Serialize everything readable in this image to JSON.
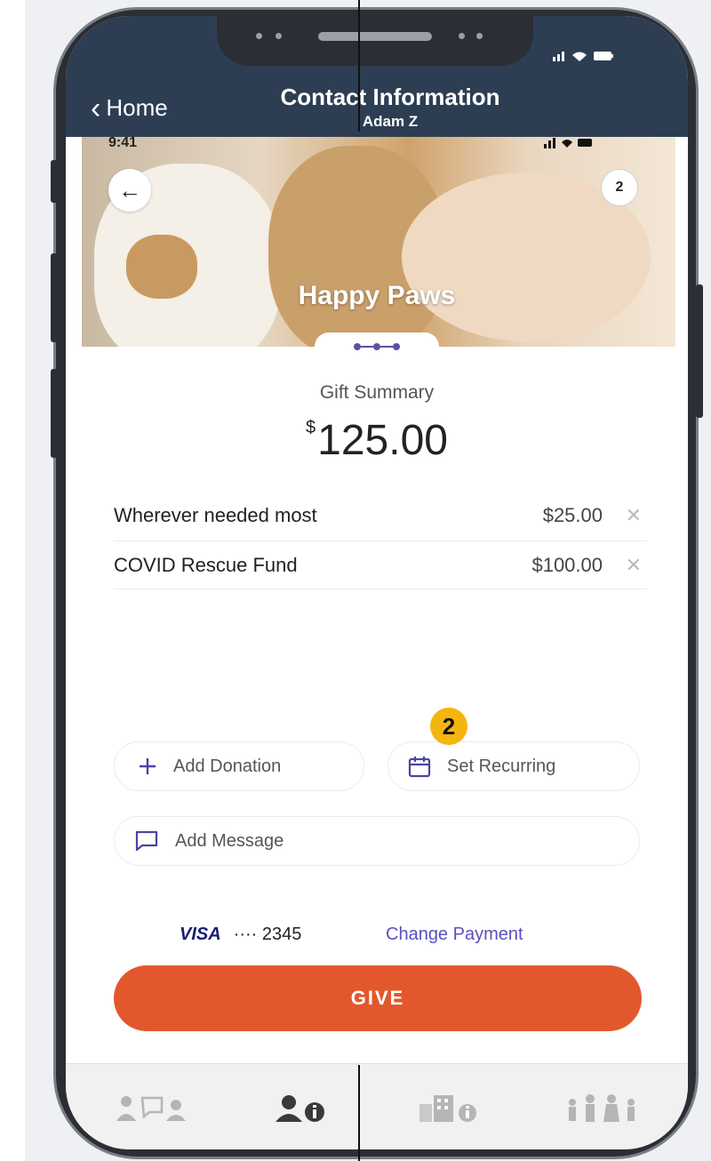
{
  "nav": {
    "back_label": "Home",
    "title": "Contact Information",
    "subtitle": "Adam Z"
  },
  "hero": {
    "status_time": "9:41",
    "title": "Happy Paws",
    "cart_count": "2"
  },
  "summary": {
    "label": "Gift Summary",
    "currency_symbol": "$",
    "amount": "125.00",
    "items": [
      {
        "name": "Wherever needed most",
        "amount": "$25.00"
      },
      {
        "name": "COVID Rescue Fund",
        "amount": "$100.00"
      }
    ]
  },
  "annotation": {
    "marker": "2"
  },
  "actions": {
    "add_donation": "Add Donation",
    "set_recurring": "Set Recurring",
    "add_message": "Add Message"
  },
  "payment": {
    "card_brand": "VISA",
    "card_masked": "···· 2345",
    "change_label": "Change Payment"
  },
  "give_button": "GIVE",
  "tabs": [
    "people-chat-icon",
    "person-info-icon",
    "building-info-icon",
    "family-icon"
  ],
  "colors": {
    "nav_bar": "#2d3e53",
    "accent_purple": "#4b44a0",
    "give_orange": "#e2582c",
    "marker_yellow": "#f5b50f"
  }
}
